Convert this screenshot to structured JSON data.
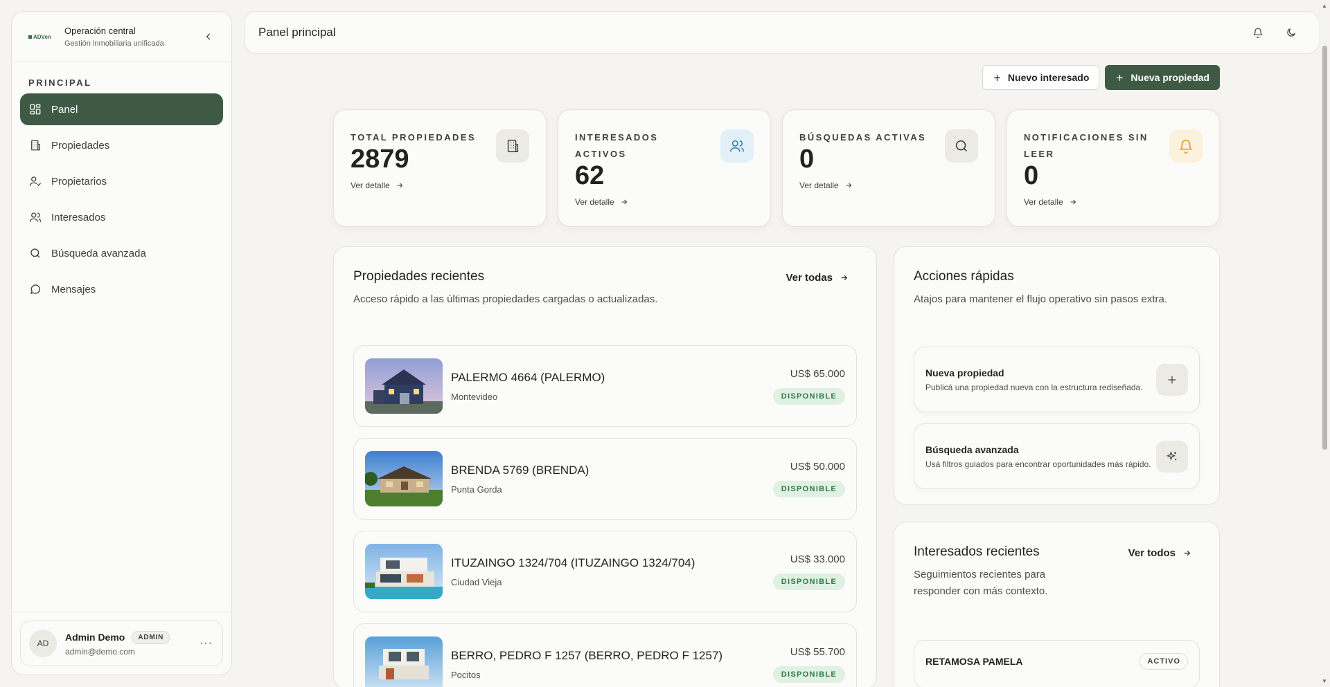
{
  "sidebar": {
    "logo_text": "ADVen",
    "org_name": "Operación central",
    "org_sub": "Gestión inmobiliaria unificada",
    "section": "PRINCIPAL",
    "items": [
      {
        "label": "Panel",
        "icon": "grid-icon"
      },
      {
        "label": "Propiedades",
        "icon": "building-icon"
      },
      {
        "label": "Propietarios",
        "icon": "user-check-icon"
      },
      {
        "label": "Interesados",
        "icon": "users-icon"
      },
      {
        "label": "Búsqueda avanzada",
        "icon": "search-icon"
      },
      {
        "label": "Mensajes",
        "icon": "message-icon"
      }
    ],
    "user": {
      "initials": "AD",
      "name": "Admin Demo",
      "role": "ADMIN",
      "email": "admin@demo.com"
    }
  },
  "header": {
    "title": "Panel principal"
  },
  "actions": {
    "new_lead": "Nuevo interesado",
    "new_property": "Nueva propiedad"
  },
  "stats": [
    {
      "label": "TOTAL PROPIEDADES",
      "value": "2879",
      "link": "Ver detalle",
      "icon": "building-icon",
      "icon_bg": "#ebeae5",
      "icon_color": "#3c413e"
    },
    {
      "label": "INTERESADOS ACTIVOS",
      "value": "62",
      "link": "Ver detalle",
      "icon": "users-icon",
      "icon_bg": "#e3f0f7",
      "icon_color": "#2b78a3"
    },
    {
      "label": "BÚSQUEDAS ACTIVAS",
      "value": "0",
      "link": "Ver detalle",
      "icon": "search-icon",
      "icon_bg": "#ebeae5",
      "icon_color": "#3c413e"
    },
    {
      "label": "NOTIFICACIONES SIN LEER",
      "value": "0",
      "link": "Ver detalle",
      "icon": "bell-icon",
      "icon_bg": "#fcf1dc",
      "icon_color": "#d9961f"
    }
  ],
  "recent": {
    "title": "Propiedades recientes",
    "subtitle": "Acceso rápido a las últimas propiedades cargadas o actualizadas.",
    "link": "Ver todas",
    "properties": [
      {
        "name": "PALERMO 4664 (PALERMO)",
        "city": "Montevideo",
        "price": "US$ 65.000",
        "status": "DISPONIBLE"
      },
      {
        "name": "BRENDA 5769 (BRENDA)",
        "city": "Punta Gorda",
        "price": "US$ 50.000",
        "status": "DISPONIBLE"
      },
      {
        "name": "ITUZAINGO 1324/704 (ITUZAINGO 1324/704)",
        "city": "Ciudad Vieja",
        "price": "US$ 33.000",
        "status": "DISPONIBLE"
      },
      {
        "name": "BERRO, PEDRO F 1257 (BERRO, PEDRO F 1257)",
        "city": "Pocitos",
        "price": "US$ 55.700",
        "status": "DISPONIBLE"
      }
    ]
  },
  "quick": {
    "title": "Acciones rápidas",
    "subtitle": "Atajos para mantener el flujo operativo sin pasos extra.",
    "items": [
      {
        "title": "Nueva propiedad",
        "desc": "Publicá una propiedad nueva con la estructura rediseñada.",
        "icon": "plus-icon"
      },
      {
        "title": "Búsqueda avanzada",
        "desc": "Usá filtros guiados para encontrar oportunidades más rápido.",
        "icon": "sparkles-icon"
      }
    ]
  },
  "leads": {
    "title": "Interesados recientes",
    "subtitle": "Seguimientos recientes para responder con más contexto.",
    "link": "Ver todos",
    "items": [
      {
        "name": "RETAMOSA PAMELA",
        "status": "ACTIVO"
      }
    ]
  }
}
